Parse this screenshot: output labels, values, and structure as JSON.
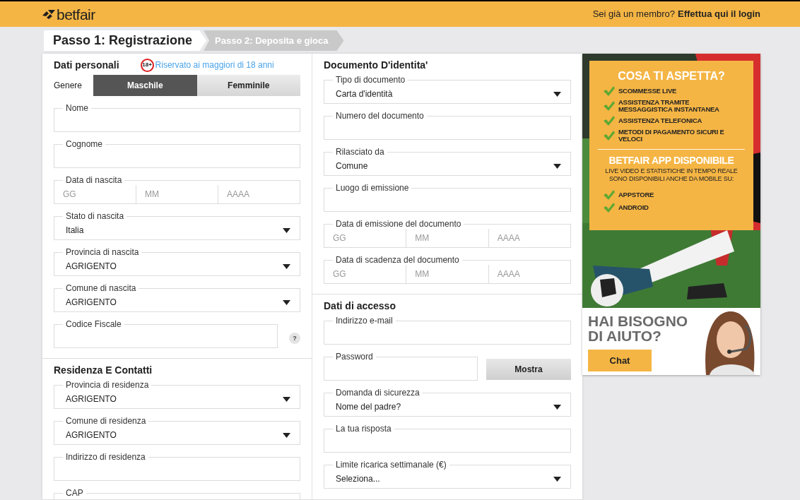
{
  "header": {
    "logo": "betfair",
    "login_prompt": "Sei già un membro?",
    "login_link": "Effettua qui il login"
  },
  "steps": [
    {
      "label": "Passo 1: Registrazione",
      "selected": true
    },
    {
      "label": "Passo 2: Deposita e gioca",
      "selected": false
    }
  ],
  "columns": [
    [
      {
        "title": "Dati personali",
        "age_badge": "18+",
        "age_note": "Riservato ai maggiori di 18 anni",
        "gender": {
          "label": "Genere",
          "options": [
            {
              "label": "Maschile",
              "selected": true
            },
            {
              "label": "Femminile",
              "selected": false
            }
          ]
        },
        "fields": [
          {
            "kind": "text",
            "label": "Nome"
          },
          {
            "kind": "text",
            "label": "Cognome"
          },
          {
            "kind": "date",
            "label": "Data di nascita",
            "placeholders": [
              "GG",
              "MM",
              "AAAA"
            ]
          },
          {
            "kind": "select",
            "label": "Stato di nascita",
            "value": "Italia"
          },
          {
            "kind": "select",
            "label": "Provincia di nascita",
            "value": "AGRIGENTO"
          },
          {
            "kind": "select",
            "label": "Comune di nascita",
            "value": "AGRIGENTO"
          },
          {
            "kind": "help",
            "label": "Codice Fiscale",
            "help": "?"
          }
        ]
      },
      {
        "title": "Residenza E Contatti",
        "fields": [
          {
            "kind": "select",
            "label": "Provincia di residenza",
            "value": "AGRIGENTO"
          },
          {
            "kind": "select",
            "label": "Comune di residenza",
            "value": "AGRIGENTO"
          },
          {
            "kind": "text",
            "label": "Indirizzo di residenza"
          },
          {
            "kind": "text",
            "label": "CAP"
          }
        ]
      }
    ],
    [
      {
        "title": "Documento D'identita'",
        "fields": [
          {
            "kind": "select",
            "label": "Tipo di documento",
            "value": "Carta d'identità"
          },
          {
            "kind": "text",
            "label": "Numero del documento"
          },
          {
            "kind": "select",
            "label": "Rilasciato da",
            "value": "Comune"
          },
          {
            "kind": "text",
            "label": "Luogo di emissione"
          },
          {
            "kind": "date",
            "label": "Data di emissione del documento",
            "placeholders": [
              "GG",
              "MM",
              "AAAA"
            ]
          },
          {
            "kind": "date",
            "label": "Data di scadenza del documento",
            "placeholders": [
              "GG",
              "MM",
              "AAAA"
            ]
          }
        ]
      },
      {
        "title": "Dati di accesso",
        "fields": [
          {
            "kind": "text",
            "label": "Indirizzo e-mail"
          },
          {
            "kind": "password",
            "label": "Password",
            "button": "Mostra"
          },
          {
            "kind": "select",
            "label": "Domanda di sicurezza",
            "value": "Nome del padre?"
          },
          {
            "kind": "text",
            "label": "La tua risposta"
          },
          {
            "kind": "select",
            "label": "Limite ricarica settimanale (€)",
            "value": "Seleziona..."
          }
        ]
      }
    ]
  ],
  "promo": {
    "title": "COSA TI ASPETTA?",
    "benefits": [
      "SCOMMESSE LIVE",
      "ASSISTENZA TRAMITE MESSAGGISTICA INSTANTANEA",
      "ASSISTENZA TELEFONICA",
      "METODI DI PAGAMENTO SICURI E VELOCI"
    ],
    "app_title": "BETFAIR APP DISPONIBILE",
    "app_text": "LIVE VIDEO E STATISTICHE IN TEMPO REALE SONO DISPONIBILI ANCHE DA MOBILE SU:",
    "stores": [
      "APPSTORE",
      "ANDROID"
    ]
  },
  "help": {
    "title": "HAI BISOGNO DI AIUTO?",
    "button": "Chat"
  }
}
